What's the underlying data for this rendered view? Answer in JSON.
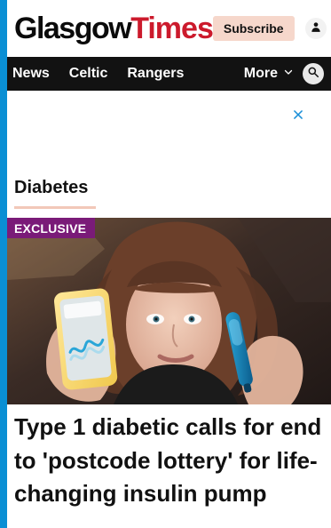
{
  "header": {
    "logo_left": "Glasgow",
    "logo_right": "Times",
    "subscribe_label": "Subscribe"
  },
  "nav": {
    "items": [
      "News",
      "Celtic",
      "Rangers"
    ],
    "more_label": "More"
  },
  "section": {
    "title": "Diabetes"
  },
  "article": {
    "badge": "EXCLUSIVE",
    "headline": "Type 1 diabetic calls for end to 'postcode lottery' for life-changing insulin pump"
  },
  "icons": {
    "account": "user-icon",
    "search": "search-icon",
    "close": "close-icon",
    "more": "chevron-down-icon"
  },
  "colors": {
    "brand_red": "#cc1a2c",
    "nav_bg": "#121212",
    "subscribe_bg": "#f6d7cb",
    "badge_bg": "#7a1b78",
    "underline": "#f2c8b8",
    "close_blue": "#1a8fd8",
    "page_border": "#0a8fd4"
  }
}
